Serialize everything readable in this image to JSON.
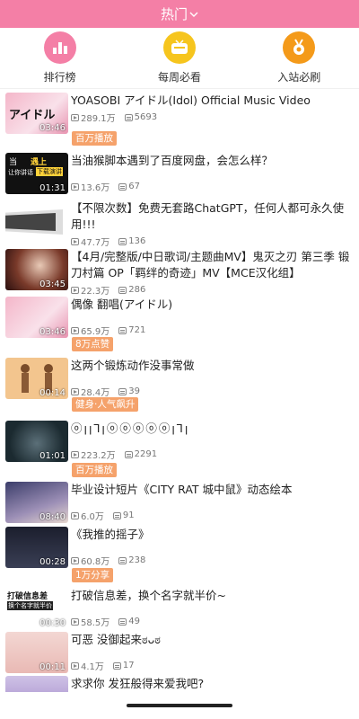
{
  "header": {
    "title": "热门",
    "chevron": "chevron-down-icon"
  },
  "quick_links": [
    {
      "label": "排行榜",
      "icon": "ranking-icon",
      "color": "#f47fa6"
    },
    {
      "label": "每周必看",
      "icon": "weekly-tv-icon",
      "color": "#f6c51e"
    },
    {
      "label": "入站必刷",
      "icon": "medal-icon",
      "color": "#f49a1a"
    }
  ],
  "videos": [
    {
      "title": "YOASOBI アイドル(Idol) Official Music Video",
      "duration": "03:46",
      "views": "289.1万",
      "danmaku": "5693",
      "badge": "百万播放"
    },
    {
      "title": "当油猴脚本遇到了百度网盘，会怎么样？",
      "duration": "01:31",
      "views": "13.6万",
      "danmaku": "67",
      "badge": ""
    },
    {
      "title": "【不限次数】免费无套路ChatGPT，任何人都可永久使用!!!",
      "duration": "",
      "views": "47.7万",
      "danmaku": "136",
      "badge": ""
    },
    {
      "title": "【4月/完整版/中日歌词/主题曲MV】鬼灭之刃 第三季 锻刀村篇 OP「羁绊的奇迹」MV【MCE汉化组】",
      "duration": "03:45",
      "views": "22.3万",
      "danmaku": "286",
      "badge": ""
    },
    {
      "title": "偶像 翻唱(アイドル)",
      "duration": "03:46",
      "views": "65.9万",
      "danmaku": "721",
      "badge": "8万点赞"
    },
    {
      "title": "这两个锻炼动作没事常做",
      "duration": "00:14",
      "views": "28.4万",
      "danmaku": "39",
      "badge": "健身·人气飙升"
    },
    {
      "title": "ⓞꞁꞁꞀꞁⓞⓞⓞⓞⓞꞁꞀꞁ",
      "duration": "01:01",
      "views": "223.2万",
      "danmaku": "2291",
      "badge": "百万播放"
    },
    {
      "title": "毕业设计短片《CITY RAT 城中鼠》动态绘本",
      "duration": "08:40",
      "views": "6.0万",
      "danmaku": "91",
      "badge": ""
    },
    {
      "title": "《我推的摇子》",
      "duration": "00:28",
      "views": "60.8万",
      "danmaku": "238",
      "badge": "1万分享"
    },
    {
      "title": "打破信息差，换个名字就半价~",
      "duration": "00:30",
      "views": "58.5万",
      "danmaku": "49",
      "badge": ""
    },
    {
      "title": "可恶 没御起来ಠᴗಠ",
      "duration": "00:11",
      "views": "4.1万",
      "danmaku": "17",
      "badge": ""
    },
    {
      "title": "求求你 发狂般得来爱我吧?",
      "duration": "",
      "views": "",
      "danmaku": "",
      "badge": ""
    }
  ],
  "thumb_text": {
    "v0": "アイドル",
    "v1_top": "当",
    "v1_mid": "遇上",
    "v1_left": "让你讲话",
    "v1_right": "下载演讲",
    "v9": "打破信息差",
    "v9_sub": "换个名字就半价"
  }
}
